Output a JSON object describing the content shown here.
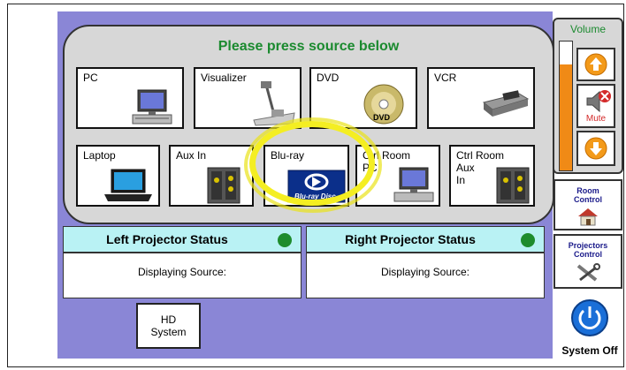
{
  "source_panel": {
    "title": "Please press source below",
    "sources": [
      {
        "label": "PC",
        "icon": "pc-icon"
      },
      {
        "label": "Visualizer",
        "icon": "visualizer-icon"
      },
      {
        "label": "DVD",
        "icon": "dvd-icon"
      },
      {
        "label": "VCR",
        "icon": "vcr-icon"
      },
      {
        "label": "Laptop",
        "icon": "laptop-icon"
      },
      {
        "label": "Aux In",
        "icon": "aux-panel-icon"
      },
      {
        "label": "Blu-ray",
        "icon": "bluray-icon",
        "highlighted": true
      },
      {
        "label": "Ctrl Room\nPC",
        "icon": "pc-icon"
      },
      {
        "label": "Ctrl Room\nAux\nIn",
        "icon": "aux-panel-icon"
      }
    ]
  },
  "left_projector": {
    "title": "Left Projector Status",
    "source_label": "Displaying Source:"
  },
  "right_projector": {
    "title": "Right Projector Status",
    "source_label": "Displaying Source:"
  },
  "hd_system": {
    "label": "HD\nSystem"
  },
  "volume": {
    "title": "Volume",
    "mute_label": "Mute",
    "level": 0.82
  },
  "room_control": {
    "label": "Room\nControl"
  },
  "projectors_control": {
    "label": "Projectors\nControl"
  },
  "system_off": {
    "label": "System Off"
  },
  "colors": {
    "accent_green": "#1b8a2f",
    "panel_purple": "#8a86d6",
    "highlight_yellow": "#f4ee22",
    "status_cyan": "#b9f2f4",
    "volume_orange": "#f08a16"
  }
}
